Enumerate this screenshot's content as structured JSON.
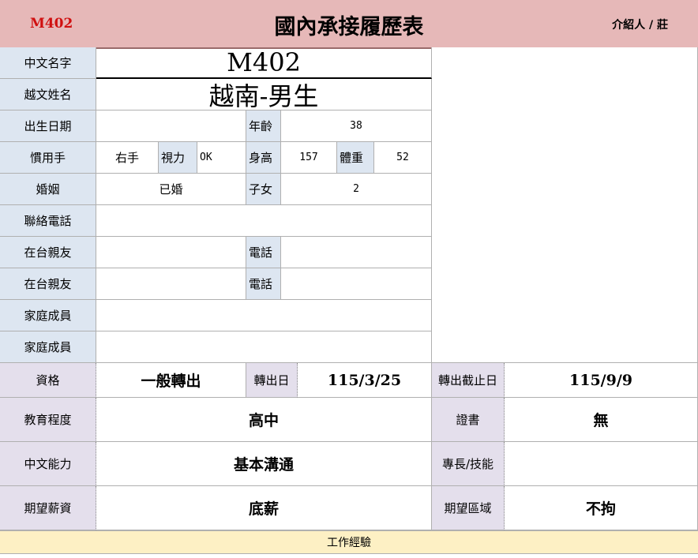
{
  "header": {
    "code": "M402",
    "title": "國內承接履歷表",
    "introducer": "介紹人 / 莊"
  },
  "labels": {
    "chinese_name": "中文名字",
    "vietnamese_name": "越文姓名",
    "birth_date": "出生日期",
    "age": "年齡",
    "handedness": "慣用手",
    "vision": "視力",
    "height": "身高",
    "weight": "體重",
    "marriage": "婚姻",
    "children": "子女",
    "contact_phone": "聯絡電話",
    "relative_1": "在台親友",
    "relative_2": "在台親友",
    "phone_1": "電話",
    "phone_2": "電話",
    "family_1": "家庭成員",
    "family_2": "家庭成員",
    "qualification": "資格",
    "transfer_date": "轉出日",
    "transfer_deadline": "轉出截止日",
    "education": "教育程度",
    "certificate": "證書",
    "chinese_ability": "中文能力",
    "skills": "專長/技能",
    "expected_salary": "期望薪資",
    "expected_area": "期望區域",
    "work_experience": "工作經驗"
  },
  "values": {
    "chinese_name": "M402",
    "vietnamese_name": "越南-男生",
    "birth_date": "",
    "age": "38",
    "handedness": "右手",
    "vision": "OK",
    "height": "157",
    "weight": "52",
    "marriage": "已婚",
    "children": "2",
    "contact_phone": "",
    "relative_1": "",
    "relative_2": "",
    "phone_1": "",
    "phone_2": "",
    "family_1": "",
    "family_2": "",
    "qualification": "一般轉出",
    "transfer_date": "115/3/25",
    "transfer_deadline": "115/9/9",
    "education": "高中",
    "certificate": "無",
    "chinese_ability": "基本溝通",
    "skills": "",
    "expected_salary": "底薪",
    "expected_area": "不拘"
  },
  "colors": {
    "header_bg": "#e6b8b8",
    "code_red": "#d01010",
    "label_blue": "#dde6f1",
    "label_lavender": "#e4dfec",
    "work_bar": "#fdf0c4"
  }
}
